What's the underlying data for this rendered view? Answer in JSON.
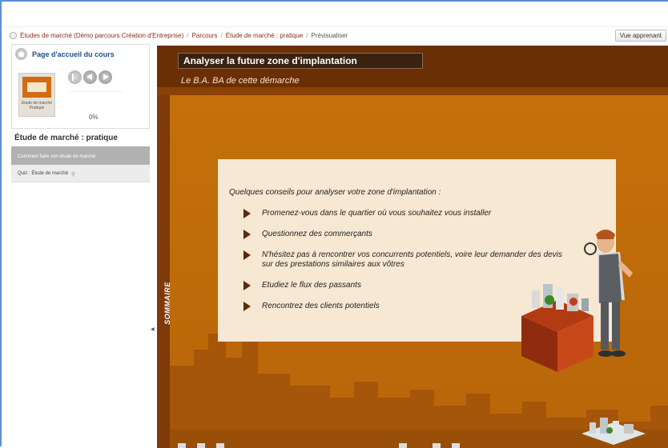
{
  "breadcrumb": {
    "items": [
      "Études de marché (Démo parcours Création d'Entreprise)",
      "Parcours",
      "Étude de marché : pratique",
      "Prévisualiser"
    ],
    "separator": "/"
  },
  "header": {
    "view_button": "Vue apprenant"
  },
  "sidebar": {
    "home_label": "Page d'accueil du cours",
    "thumbnail_caption": "Étude de marché Pratique",
    "progress_percent": "0%",
    "module_title": "Étude de marché : pratique",
    "activities": [
      {
        "label": "Comment faire son étude de marché",
        "selected": true
      },
      {
        "label": "Quiz : Étude de marché",
        "selected": false
      }
    ]
  },
  "player": {
    "title": "Analyser la future zone d'implantation",
    "subtitle": "Le B.A. BA de cette démarche",
    "side_tab": "SOMMAIRE",
    "intro": "Quelques conseils pour analyser votre zone d'implantation :",
    "tips": [
      "Promenez-vous dans le quartier où vous souhaitez vous installer",
      "Questionnez des commerçants",
      "N'hésitez pas à rencontrer vos concurrents potentiels, voire leur demander des devis sur des prestations similaires aux vôtres",
      "Etudiez le flux des passants",
      "Rencontrez des clients potentiels"
    ]
  },
  "colors": {
    "player_bg": "#c4700b",
    "top_band": "#6b2f06",
    "card_bg": "#f6e8d2",
    "link": "#8a2d14",
    "accent_blue": "#1d4f8e"
  }
}
